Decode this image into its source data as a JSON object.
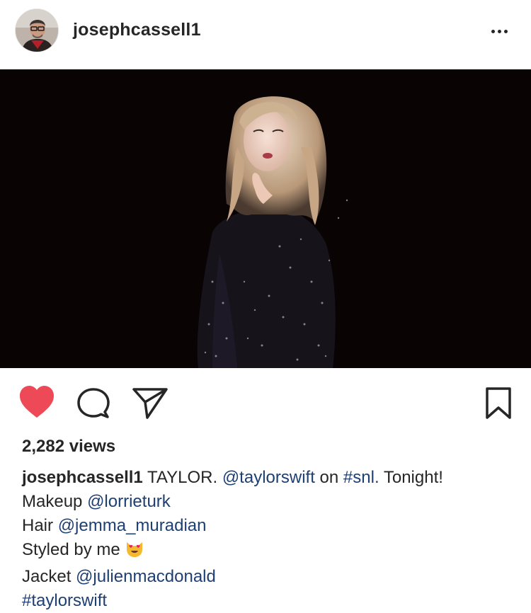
{
  "post": {
    "username": "josephcassell1",
    "views": "2,282 views"
  },
  "icons": {
    "like": "heart-icon",
    "comment": "comment-icon",
    "share": "paper-plane-icon",
    "save": "bookmark-icon",
    "more": "more-options-icon"
  },
  "colors": {
    "like_active": "#ed4956",
    "link": "#1e3f72",
    "text": "#262626"
  },
  "caption": {
    "username": "josephcassell1",
    "line1_text": "TAYLOR.",
    "mention_taylor": "@taylorswift",
    "on_word": "on",
    "hashtag_snl": "#snl.",
    "tonight": "Tonight!",
    "makeup_label": "Makeup",
    "makeup_mention": "@lorrieturk",
    "hair_label": "Hair",
    "hair_mention": "@jemma_muradian",
    "styled_label": "Styled by me",
    "styled_emoji": "heart-eyes-cat-emoji",
    "jacket_label": "Jacket",
    "jacket_mention": "@julienmacdonald",
    "hashtag_taylorswift": "#taylorswift"
  }
}
